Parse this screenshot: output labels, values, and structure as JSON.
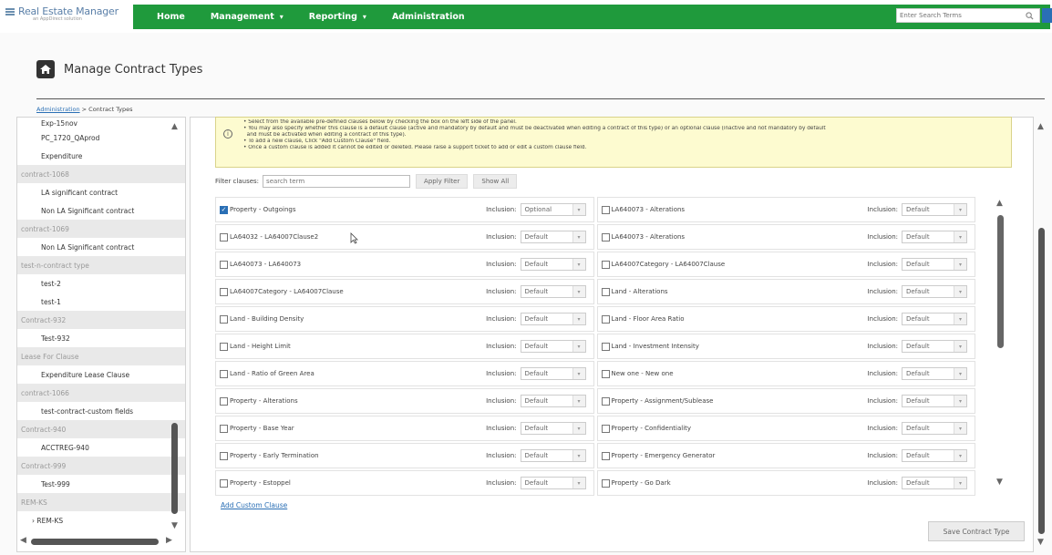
{
  "app": {
    "name": "Real Estate Manager",
    "subtitle": "an AppDirect solution"
  },
  "nav": {
    "items": [
      {
        "label": "Home",
        "caret": false
      },
      {
        "label": "Management",
        "caret": true
      },
      {
        "label": "Reporting",
        "caret": true
      },
      {
        "label": "Administration",
        "caret": false
      }
    ],
    "search_placeholder": "Enter Search Terms"
  },
  "page": {
    "title": "Manage Contract Types",
    "breadcrumb_link": "Administration",
    "breadcrumb_sep": " > ",
    "breadcrumb_current": "Contract Types"
  },
  "contract_list": [
    {
      "type": "item",
      "label": "Exp-15nov"
    },
    {
      "type": "item",
      "label": "PC_1720_QAprod"
    },
    {
      "type": "item",
      "label": "Expenditure"
    },
    {
      "type": "group",
      "label": "contract-1068"
    },
    {
      "type": "item",
      "label": "LA significant contract"
    },
    {
      "type": "item",
      "label": "Non LA Significant contract"
    },
    {
      "type": "group",
      "label": "contract-1069"
    },
    {
      "type": "item",
      "label": "Non LA Significant contract"
    },
    {
      "type": "group",
      "label": "test-n-contract type"
    },
    {
      "type": "item",
      "label": "test-2"
    },
    {
      "type": "item",
      "label": "test-1"
    },
    {
      "type": "group",
      "label": "Contract-932"
    },
    {
      "type": "item",
      "label": "Test-932"
    },
    {
      "type": "group",
      "label": "Lease For Clause"
    },
    {
      "type": "item",
      "label": "Expenditure Lease Clause"
    },
    {
      "type": "group",
      "label": "contract-1066"
    },
    {
      "type": "item",
      "label": "test-contract-custom fields"
    },
    {
      "type": "group",
      "label": "Contract-940"
    },
    {
      "type": "item",
      "label": "ACCTREG-940"
    },
    {
      "type": "group",
      "label": "Contract-999"
    },
    {
      "type": "item",
      "label": "Test-999"
    },
    {
      "type": "group",
      "label": "REM-KS"
    },
    {
      "type": "sub",
      "label": "› REM-KS"
    }
  ],
  "info": {
    "lines": [
      "• Select from the available pre-defined clauses below by checking the box on the left side of the panel.",
      "• You may also specify whether this clause is a default clause (active and mandatory by default and must be deactivated when editing a contract of this type) or an optional clause (inactive and not mandatory by default",
      "  and must be activated when editing a contract of this type).",
      "• To add a new clause, Click \"Add Custom Clause\" field.",
      "• Once a custom clause is added it cannot be edited or deleted. Please raise a support ticket to add or edit a custom clause field."
    ]
  },
  "filter": {
    "label": "Filter clauses:",
    "placeholder": "search term",
    "apply_label": "Apply Filter",
    "show_all_label": "Show All"
  },
  "inclusion_label": "Inclusion:",
  "clauses": [
    [
      {
        "name": "Property - Outgoings",
        "checked": true,
        "inclusion": "Optional"
      },
      {
        "name": "LA640073 - Alterations",
        "checked": false,
        "inclusion": "Default"
      }
    ],
    [
      {
        "name": "LA64032 - LA64007Clause2",
        "checked": false,
        "inclusion": "Default"
      },
      {
        "name": "LA640073 - Alterations",
        "checked": false,
        "inclusion": "Default"
      }
    ],
    [
      {
        "name": "LA640073 - LA640073",
        "checked": false,
        "inclusion": "Default"
      },
      {
        "name": "LA64007Category - LA64007Clause",
        "checked": false,
        "inclusion": "Default"
      }
    ],
    [
      {
        "name": "LA64007Category - LA64007Clause",
        "checked": false,
        "inclusion": "Default"
      },
      {
        "name": "Land - Alterations",
        "checked": false,
        "inclusion": "Default"
      }
    ],
    [
      {
        "name": "Land - Building Density",
        "checked": false,
        "inclusion": "Default"
      },
      {
        "name": "Land - Floor Area Ratio",
        "checked": false,
        "inclusion": "Default"
      }
    ],
    [
      {
        "name": "Land - Height Limit",
        "checked": false,
        "inclusion": "Default"
      },
      {
        "name": "Land - Investment Intensity",
        "checked": false,
        "inclusion": "Default"
      }
    ],
    [
      {
        "name": "Land - Ratio of Green Area",
        "checked": false,
        "inclusion": "Default"
      },
      {
        "name": "New one - New one",
        "checked": false,
        "inclusion": "Default"
      }
    ],
    [
      {
        "name": "Property - Alterations",
        "checked": false,
        "inclusion": "Default"
      },
      {
        "name": "Property - Assignment/Sublease",
        "checked": false,
        "inclusion": "Default"
      }
    ],
    [
      {
        "name": "Property - Base Year",
        "checked": false,
        "inclusion": "Default"
      },
      {
        "name": "Property - Confidentiality",
        "checked": false,
        "inclusion": "Default"
      }
    ],
    [
      {
        "name": "Property - Early Termination",
        "checked": false,
        "inclusion": "Default"
      },
      {
        "name": "Property - Emergency Generator",
        "checked": false,
        "inclusion": "Default"
      }
    ],
    [
      {
        "name": "Property - Estoppel",
        "checked": false,
        "inclusion": "Default"
      },
      {
        "name": "Property - Go Dark",
        "checked": false,
        "inclusion": "Default"
      }
    ]
  ],
  "actions": {
    "add_custom_clause": "Add Custom Clause",
    "save_contract_type": "Save Contract Type"
  },
  "colors": {
    "nav_green": "#1f9a3c",
    "link_blue": "#2a6fb5",
    "info_bg": "#fdfbd0"
  }
}
